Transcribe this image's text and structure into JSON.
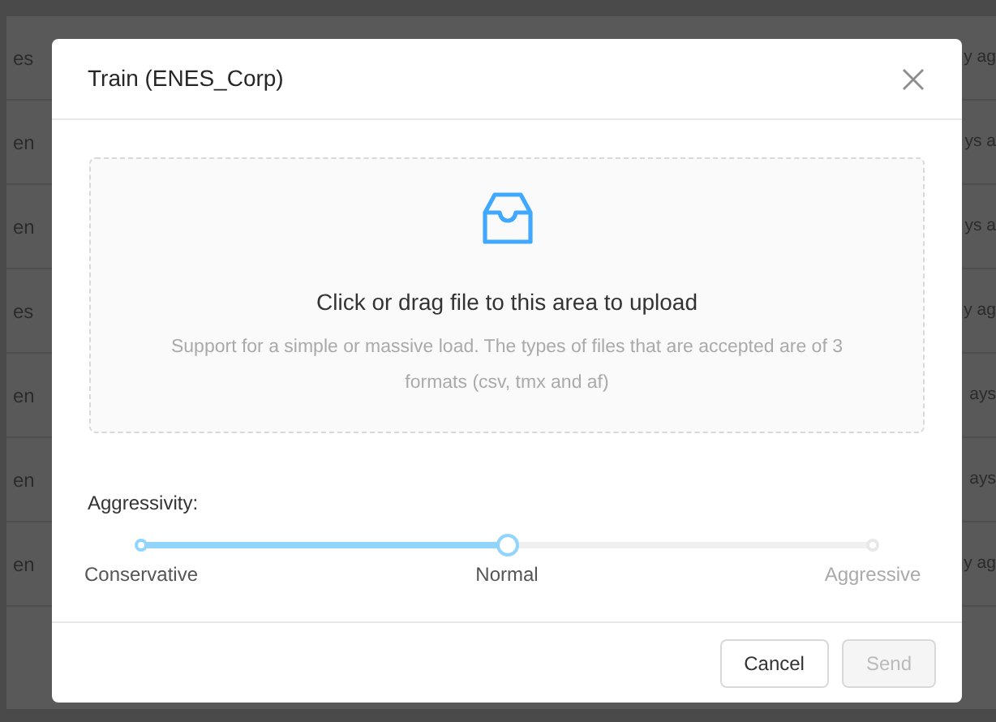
{
  "background_table": {
    "rows": [
      {
        "column_1": "es",
        "column_2": "y ag"
      },
      {
        "column_1": "en",
        "column_2": "ys a"
      },
      {
        "column_1": "en",
        "column_2": "ys a"
      },
      {
        "column_1": "es",
        "column_2": "y ag"
      },
      {
        "column_1": "en",
        "column_2": "ays"
      },
      {
        "column_1": "en",
        "column_2": "ays"
      },
      {
        "column_1": "en",
        "column_2": "y ag"
      }
    ]
  },
  "dialog": {
    "title": "Train (ENES_Corp)",
    "upload": {
      "title": "Click or drag file to this area to upload",
      "hint": "Support for a simple or massive load. The types of files that are accepted are of 3 formats (csv, tmx and af)"
    },
    "slider": {
      "label": "Aggressivity:",
      "level": 0.5,
      "marks": [
        "Conservative",
        "Normal",
        "Aggressive"
      ]
    },
    "buttons": [
      {
        "label": "Cancel",
        "disabled": false
      },
      {
        "label": "Send",
        "disabled": true
      }
    ]
  }
}
